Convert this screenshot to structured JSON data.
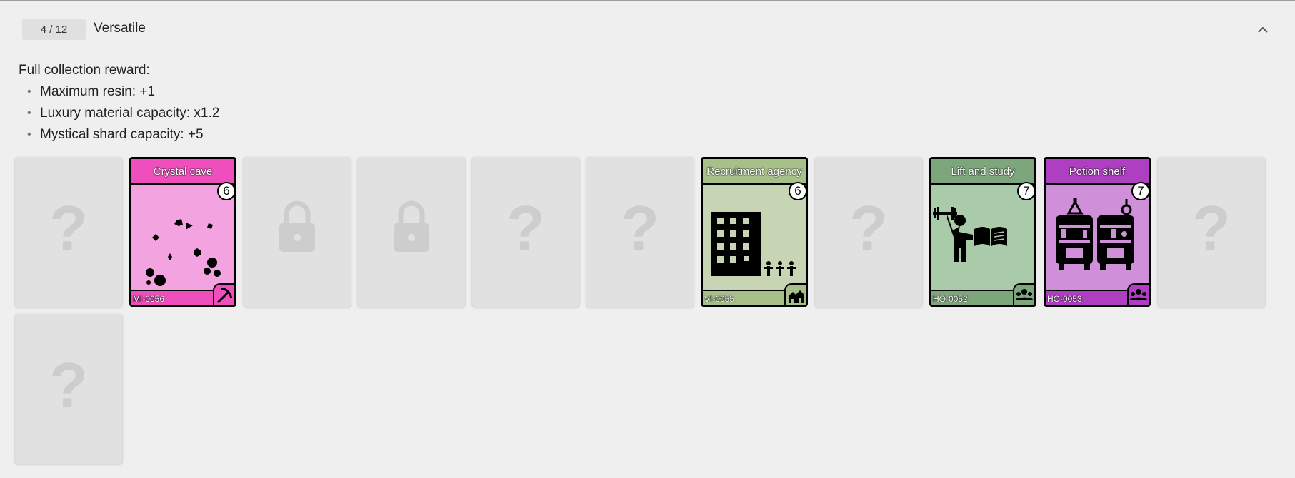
{
  "header": {
    "progress_text": "4 / 12",
    "collection_title": "Versatile"
  },
  "reward": {
    "heading": "Full collection reward:",
    "items": [
      "Maximum resin: +1",
      "Luxury material capacity: x1.2",
      "Mystical shard capacity: +5"
    ]
  },
  "cards": [
    {
      "state": "unknown"
    },
    {
      "state": "owned",
      "name": "Crystal cave",
      "cost": "6",
      "id": "MI-0056",
      "icon": "pickaxe-icon",
      "colors": {
        "header": "#ee4fbd",
        "art": "#f2a3e0",
        "footer": "#ee4fbd"
      }
    },
    {
      "state": "locked"
    },
    {
      "state": "locked"
    },
    {
      "state": "unknown"
    },
    {
      "state": "unknown"
    },
    {
      "state": "owned",
      "name": "Recruitment agency",
      "cost": "6",
      "id": "VI-0055",
      "icon": "village-icon",
      "colors": {
        "header": "#a7c08a",
        "art": "#c7d5b4",
        "footer": "#a7c08a"
      }
    },
    {
      "state": "unknown"
    },
    {
      "state": "owned",
      "name": "Lift and study",
      "cost": "7",
      "id": "HO-0052",
      "icon": "people-icon",
      "colors": {
        "header": "#7ea67c",
        "art": "#a9cba9",
        "footer": "#7ea67c"
      }
    },
    {
      "state": "owned",
      "name": "Potion shelf",
      "cost": "7",
      "id": "HO-0053",
      "icon": "people-icon",
      "colors": {
        "header": "#ae3fc0",
        "art": "#cf8fd9",
        "footer": "#ae3fc0"
      }
    },
    {
      "state": "unknown"
    },
    {
      "state": "unknown"
    }
  ]
}
